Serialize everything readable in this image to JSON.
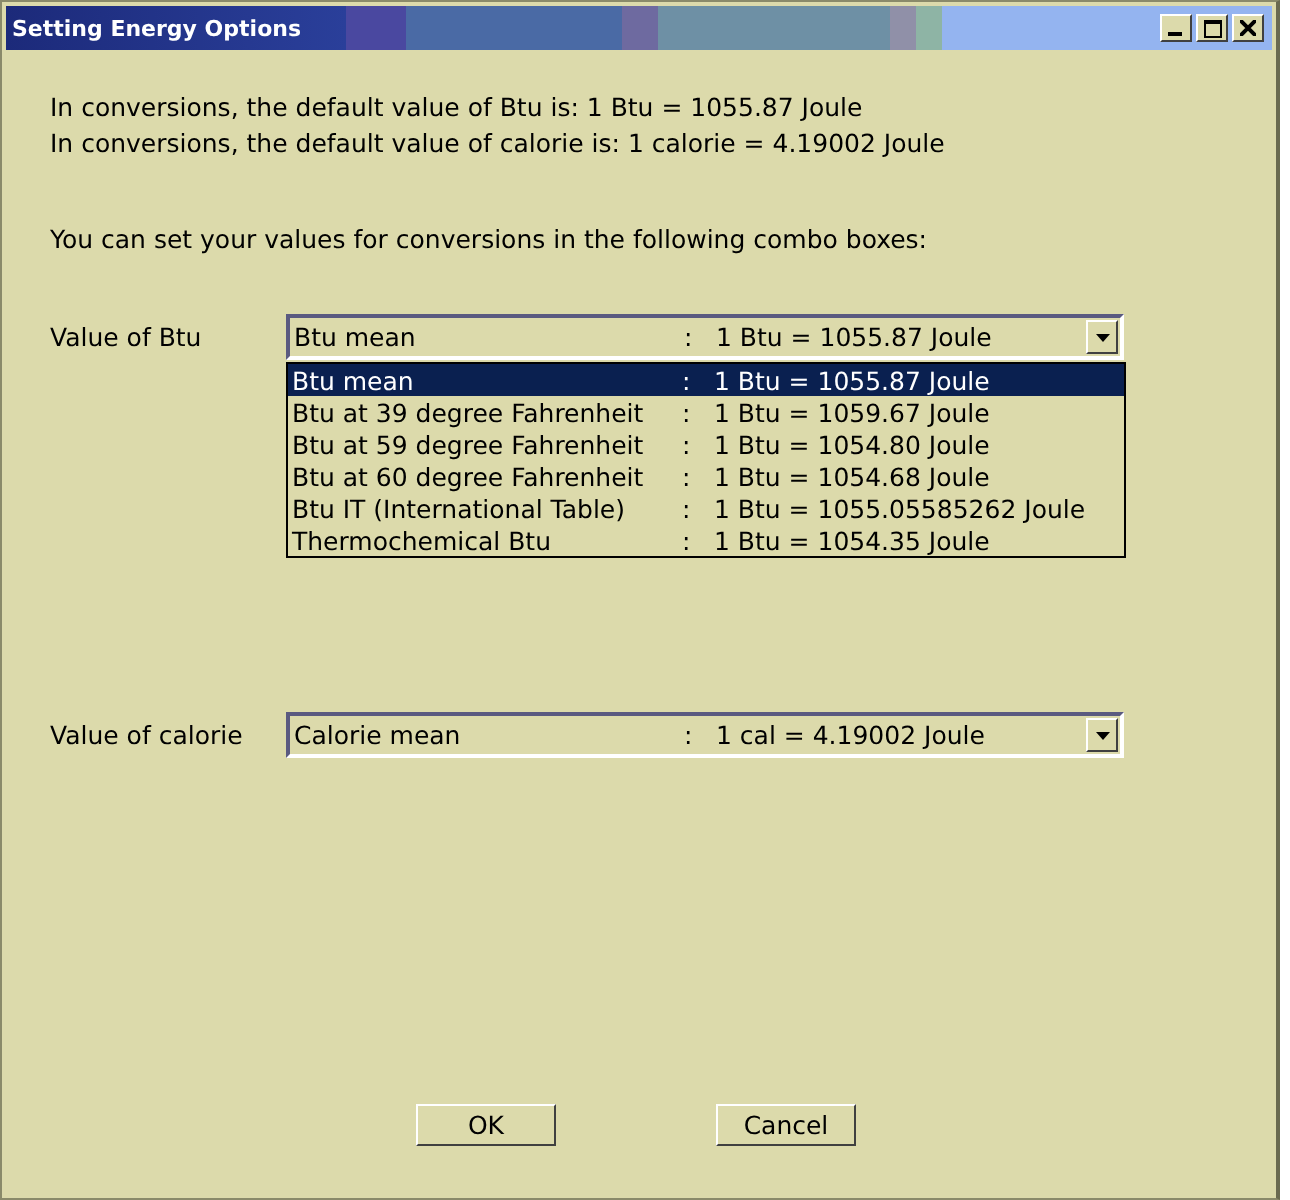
{
  "window": {
    "title": "Setting Energy Options"
  },
  "info": [
    "In conversions, the default value of Btu is: 1 Btu = 1055.87 Joule",
    "In conversions, the default value of calorie is: 1 calorie = 4.19002 Joule"
  ],
  "instruction": "You can set your values for conversions in the following combo boxes:",
  "combos": [
    {
      "label": "Value of Btu",
      "name": "Btu mean",
      "value": "1 Btu = 1055.87  Joule",
      "expanded": true,
      "options": [
        {
          "name": "Btu mean",
          "value": "1 Btu = 1055.87  Joule",
          "selected": true
        },
        {
          "name": "Btu at 39 degree Fahrenheit",
          "value": "1 Btu = 1059.67  Joule",
          "selected": false
        },
        {
          "name": "Btu at 59 degree Fahrenheit",
          "value": "1 Btu = 1054.80  Joule",
          "selected": false
        },
        {
          "name": "Btu at 60 degree Fahrenheit",
          "value": "1 Btu = 1054.68  Joule",
          "selected": false
        },
        {
          "name": "Btu IT (International Table)",
          "value": "1 Btu = 1055.05585262 Joule",
          "selected": false
        },
        {
          "name": "Thermochemical Btu",
          "value": "1 Btu = 1054.35  Joule",
          "selected": false
        }
      ]
    },
    {
      "label": "Value of calorie",
      "name": "Calorie mean",
      "value": "1 cal = 4.19002   Joule"
    }
  ],
  "separator": ":",
  "buttons": [
    "OK",
    "Cancel"
  ]
}
